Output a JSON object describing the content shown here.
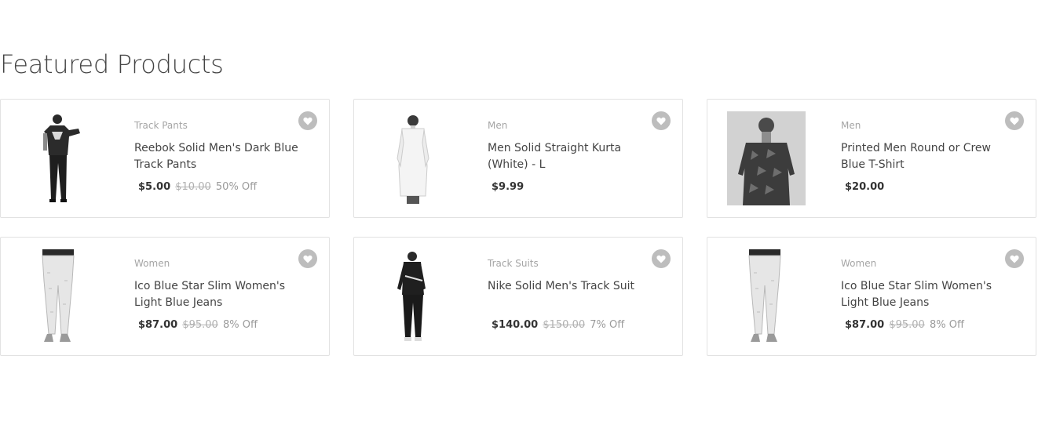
{
  "section": {
    "title": "Featured Products"
  },
  "colors": {
    "wishlist_button": "#bdbdbd",
    "card_border": "#e2e2e2",
    "category_text": "#a5a5a5"
  },
  "products": [
    {
      "category": "Track Pants",
      "name": "Reebok Solid Men's Dark Blue Track Pants",
      "price": "$5.00",
      "old_price": "$10.00",
      "discount": "50% Off",
      "image": "man-black-tshirt-track-pants",
      "icon": "heart-icon"
    },
    {
      "category": "Men",
      "name": "Men Solid Straight Kurta (White) - L",
      "price": "$9.99",
      "old_price": "",
      "discount": "",
      "image": "man-white-kurta",
      "icon": "heart-icon"
    },
    {
      "category": "Men",
      "name": "Printed Men Round or Crew Blue T-Shirt",
      "price": "$20.00",
      "old_price": "",
      "discount": "",
      "image": "man-printed-tshirt",
      "icon": "heart-icon"
    },
    {
      "category": "Women",
      "name": "Ico Blue Star Slim Women's Light Blue Jeans",
      "price": "$87.00",
      "old_price": "$95.00",
      "discount": "8% Off",
      "image": "woman-light-jeans",
      "icon": "heart-icon"
    },
    {
      "category": "Track Suits",
      "name": "Nike Solid Men's Track Suit",
      "price": "$140.00",
      "old_price": "$150.00",
      "discount": "7% Off",
      "image": "man-black-track-suit",
      "icon": "heart-icon"
    },
    {
      "category": "Women",
      "name": "Ico Blue Star Slim Women's Light Blue Jeans",
      "price": "$87.00",
      "old_price": "$95.00",
      "discount": "8% Off",
      "image": "woman-light-jeans",
      "icon": "heart-icon"
    }
  ]
}
